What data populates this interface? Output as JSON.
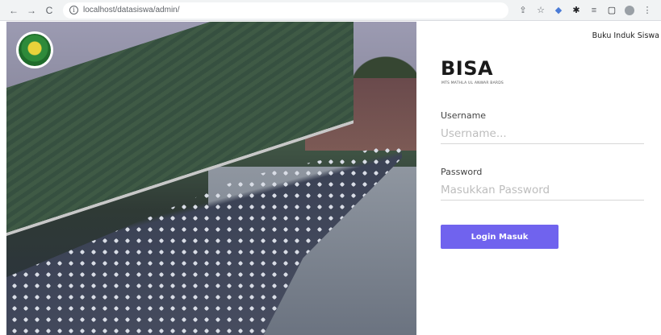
{
  "browser": {
    "back_icon": "←",
    "forward_icon": "→",
    "reload_icon": "C",
    "info_icon": "i",
    "url": "localhost/datasiswa/admin/",
    "toolbar_icons": [
      "share-icon",
      "star-icon",
      "extension-icon",
      "puzzle-icon",
      "reading-list-icon",
      "side-panel-icon",
      "profile-icon",
      "menu-icon"
    ],
    "share_glyph": "⇪",
    "star_glyph": "☆",
    "extension_glyph": "◆",
    "puzzle_glyph": "✱",
    "reading_glyph": "≡",
    "panel_glyph": "▢",
    "menu_glyph": "⋮"
  },
  "header": {
    "brand_link": "Buku Induk Siswa"
  },
  "login": {
    "title": "BISA",
    "subtitle": "MTS MATHLA UL ANWAR BARDS",
    "username_label": "Username",
    "username_placeholder": "Username...",
    "password_label": "Password",
    "password_placeholder": "Masukkan Password",
    "submit_label": "Login Masuk"
  },
  "colors": {
    "accent": "#7063ee",
    "text_dark": "#1a1a1a",
    "placeholder": "#bdbdbd"
  }
}
